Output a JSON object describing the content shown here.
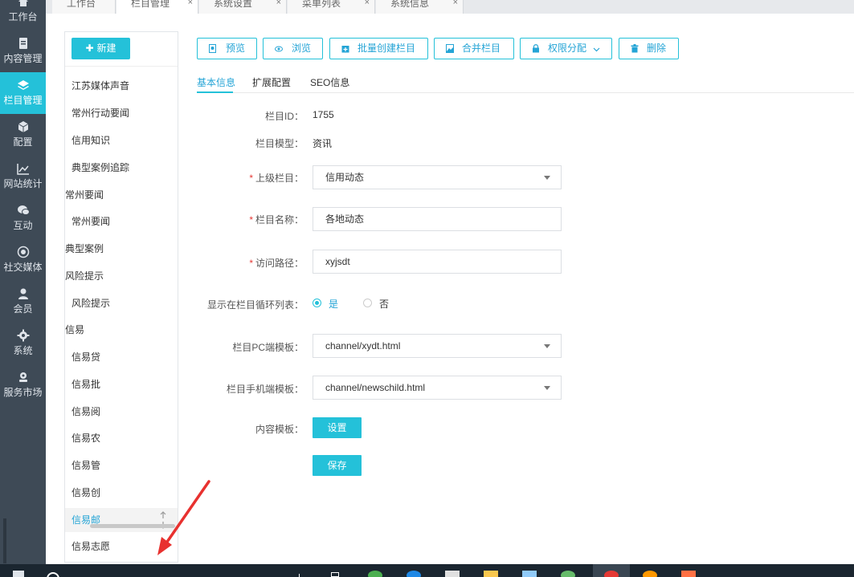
{
  "nav": {
    "items": [
      {
        "label": "工作台",
        "icon": "home-icon"
      },
      {
        "label": "内容管理",
        "icon": "document-icon"
      },
      {
        "label": "栏目管理",
        "icon": "layers-icon"
      },
      {
        "label": "配置",
        "icon": "cube-icon"
      },
      {
        "label": "网站统计",
        "icon": "line-chart-icon"
      },
      {
        "label": "互动",
        "icon": "chat-bubbles-icon"
      },
      {
        "label": "社交媒体",
        "icon": "target-icon"
      },
      {
        "label": "会员",
        "icon": "user-icon"
      },
      {
        "label": "系统",
        "icon": "gear-icon"
      },
      {
        "label": "服务市场",
        "icon": "market-icon"
      }
    ],
    "active": "栏目管理"
  },
  "tabs": [
    {
      "label": "工作台",
      "closable": false
    },
    {
      "label": "栏目管理",
      "closable": true
    },
    {
      "label": "系统设置",
      "closable": true
    },
    {
      "label": "菜单列表",
      "closable": true
    },
    {
      "label": "系统信息",
      "closable": true
    }
  ],
  "tree": {
    "new_label": "新建",
    "items": [
      "江苏媒体声音",
      "常州行动要闻",
      "信用知识",
      "典型案例追踪",
      "常州要闻",
      "常州要闻",
      "典型案例",
      "风险提示",
      "风险提示",
      "信易",
      "信易贷",
      "信易批",
      "信易阅",
      "信易农",
      "信易管",
      "信易创",
      "信易邮",
      "信易志愿"
    ],
    "active_item": "信易邮"
  },
  "toolbar": {
    "preview": "预览",
    "browse": "浏览",
    "batch_create": "批量创建栏目",
    "merge": "合并栏目",
    "permissions": "权限分配",
    "delete": "删除"
  },
  "form_tabs": {
    "basic": "基本信息",
    "extended": "扩展配置",
    "seo": "SEO信息",
    "active": "基本信息"
  },
  "form": {
    "id_label": "栏目ID：",
    "id_value": "1755",
    "model_label": "栏目模型：",
    "model_value": "资讯",
    "parent_label": "上级栏目：",
    "parent_value": "信用动态",
    "name_label": "栏目名称：",
    "name_value": "各地动态",
    "path_label": "访问路径：",
    "path_value": "xyjsdt",
    "show_label": "显示在栏目循环列表：",
    "show_yes": "是",
    "show_no": "否",
    "show_selected": "是",
    "pc_label": "栏目PC端模板：",
    "pc_value": "channel/xydt.html",
    "mobile_label": "栏目手机端模板：",
    "mobile_value": "channel/newschild.html",
    "content_label": "内容模板：",
    "content_btn": "设置",
    "save_btn": "保存"
  },
  "colors": {
    "accent": "#24c1d9",
    "nav_bg": "#3e4a56",
    "required": "#e53935"
  }
}
